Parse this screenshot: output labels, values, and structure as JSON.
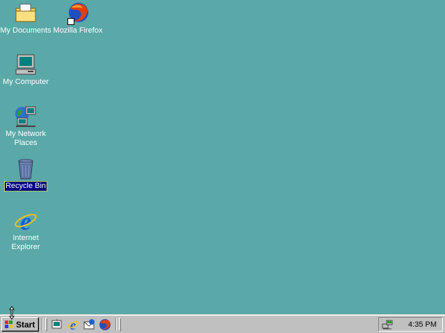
{
  "desktop": {
    "background_color": "#5aa8a8",
    "icons": [
      {
        "label": "My Documents",
        "icon": "my-documents-icon",
        "selected": false
      },
      {
        "label": "Mozilla Firefox",
        "icon": "firefox-icon",
        "selected": false,
        "shortcut": true
      },
      {
        "label": "My Computer",
        "icon": "my-computer-icon",
        "selected": false
      },
      {
        "label": "My Network Places",
        "icon": "network-places-icon",
        "selected": false
      },
      {
        "label": "Recycle Bin",
        "icon": "recycle-bin-icon",
        "selected": true
      },
      {
        "label": "Internet Explorer",
        "icon": "internet-explorer-icon",
        "selected": false
      }
    ]
  },
  "taskbar": {
    "start_label": "Start",
    "quick_launch": [
      "show-desktop-icon",
      "internet-explorer-icon",
      "outlook-express-icon",
      "firefox-icon"
    ],
    "tray": {
      "icon": "network-tray-icon",
      "time": "4:35 PM"
    }
  }
}
